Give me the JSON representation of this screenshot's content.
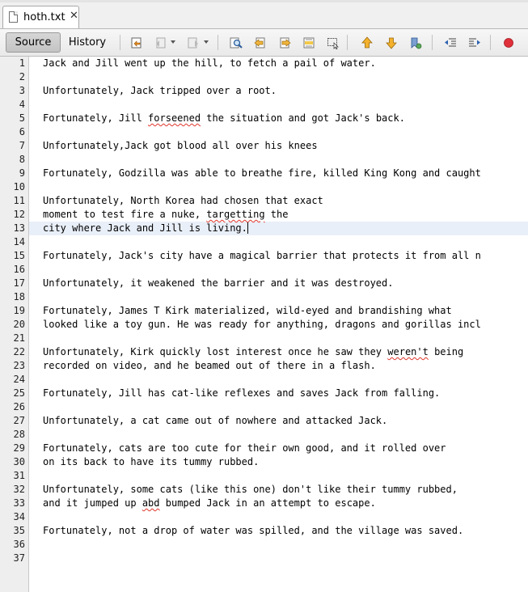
{
  "tab": {
    "filename": "hoth.txt",
    "close_glyph": "✕",
    "icon": "text-file-icon"
  },
  "toolbar": {
    "source_label": "Source",
    "history_label": "History",
    "icons": [
      "last-edit-icon",
      "back-icon",
      "forward-icon",
      "find-icon",
      "find-previous-icon",
      "find-next-icon",
      "toggle-highlight-icon",
      "toggle-rectangular-selection-icon",
      "previous-bookmark-icon",
      "next-bookmark-icon",
      "toggle-bookmark-icon",
      "shift-left-icon",
      "shift-right-icon",
      "record-macro-icon"
    ]
  },
  "editor": {
    "current_line": 13,
    "lines": [
      "Jack and Jill went up the hill, to fetch a pail of water.",
      "",
      "Unfortunately, Jack tripped over a root.",
      "",
      "Fortunately, Jill forseened the situation and got Jack's back.",
      "",
      "Unfortunately,Jack got blood all over his knees",
      "",
      "Fortunately, Godzilla was able to breathe fire, killed King Kong and caught",
      "",
      "Unfortunately, North Korea had chosen that exact",
      "moment to test fire a nuke, targetting the",
      "city where Jack and Jill is living.",
      "",
      "Fortunately, Jack's city have a magical barrier that protects it from all n",
      "",
      "Unfortunately, it weakened the barrier and it was destroyed.",
      "",
      "Fortunately, James T Kirk materialized, wild-eyed and brandishing what",
      "looked like a toy gun. He was ready for anything, dragons and gorillas incl",
      "",
      "Unfortunately, Kirk quickly lost interest once he saw they weren't being",
      "recorded on video, and he beamed out of there in a flash.",
      "",
      "Fortunately, Jill has cat-like reflexes and saves Jack from falling.",
      "",
      "Unfortunately, a cat came out of nowhere and attacked Jack.",
      "",
      "Fortunately, cats are too cute for their own good, and it rolled over",
      "on its back to have its tummy rubbed.",
      "",
      "Unfortunately, some cats (like this one) don't like their tummy rubbed,",
      "and it jumped up abd bumped Jack in an attempt to escape.",
      "",
      "Fortunately, not a drop of water was spilled, and the village was saved.",
      "",
      ""
    ],
    "misspelled": [
      "forseened",
      "targetting",
      "weren't",
      "abd"
    ]
  },
  "colors": {
    "current_line": "#e9eff8",
    "squiggle": "#e0352b",
    "record": "#e0303a"
  }
}
